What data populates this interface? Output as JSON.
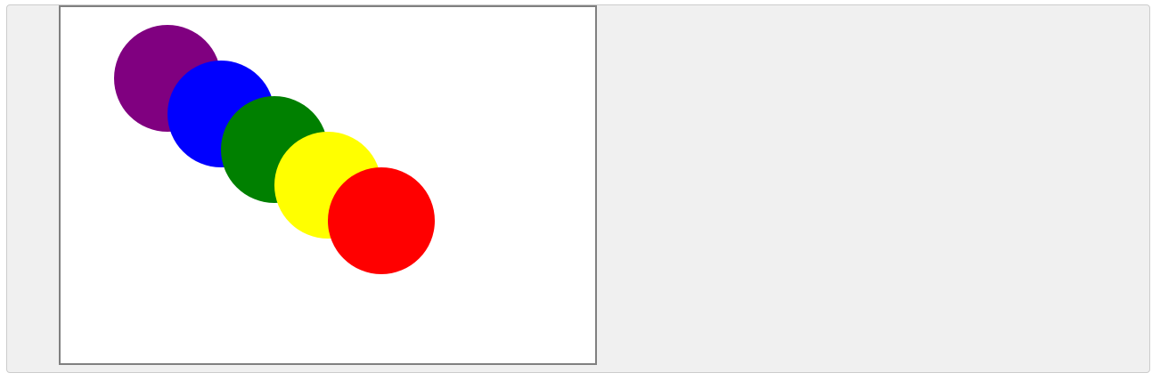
{
  "canvas": {
    "background": "#ffffff",
    "border_color": "#808080"
  },
  "circles": [
    {
      "name": "purple-circle",
      "color": "#800080"
    },
    {
      "name": "blue-circle",
      "color": "#0000ff"
    },
    {
      "name": "green-circle",
      "color": "#008000"
    },
    {
      "name": "yellow-circle",
      "color": "#ffff00"
    },
    {
      "name": "red-circle",
      "color": "#ff0000"
    }
  ]
}
